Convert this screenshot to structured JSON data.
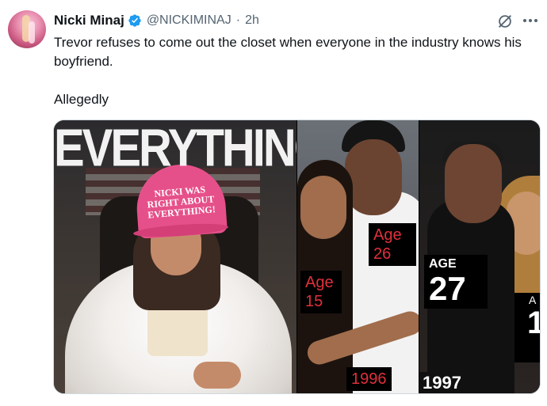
{
  "author": {
    "name": "Nicki Minaj",
    "handle": "@NICKIMINAJ",
    "separator": "·",
    "time": "2h",
    "verified_icon": "verified-badge-icon"
  },
  "actions": {
    "grok_icon": "grok-icon",
    "more_icon": "more-icon"
  },
  "tweet": {
    "line1": "Trevor refuses to come out the closet when everyone in the industry knows his boyfriend.",
    "line2": "Allegedly"
  },
  "media": {
    "left": {
      "headline": "EVERYTHING",
      "hat_text_1": "NICKI WAS",
      "hat_text_2": "RIGHT ABOUT",
      "hat_text_3": "EVERYTHING!"
    },
    "middle": {
      "age_a_label": "Age",
      "age_a_value": "15",
      "age_b_label": "Age",
      "age_b_value": "26",
      "year": "1996"
    },
    "right": {
      "age_label": "AGE",
      "age_value": "27",
      "year": "1997",
      "cut_label": "A",
      "cut_value": "1"
    }
  },
  "colors": {
    "text_primary": "#0f1419",
    "text_secondary": "#536471",
    "verified_blue": "#1d9bf0",
    "hat_pink": "#e6508a",
    "label_red": "#e0303a"
  }
}
